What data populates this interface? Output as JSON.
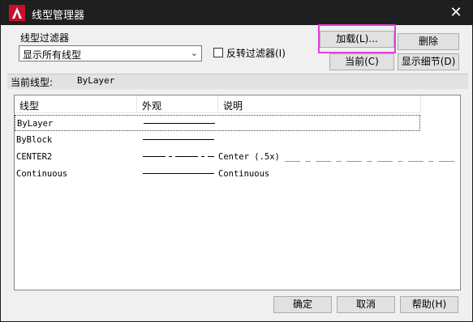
{
  "window": {
    "title": "线型管理器"
  },
  "filter": {
    "group_label": "线型过滤器",
    "selected": "显示所有线型",
    "invert_label": "反转过滤器(I)"
  },
  "buttons": {
    "load": "加载(L)...",
    "delete": "删除",
    "current": "当前(C)",
    "details": "显示细节(D)",
    "ok": "确定",
    "cancel": "取消",
    "help": "帮助(H)"
  },
  "current_linetype": {
    "label": "当前线型:",
    "value": "ByLayer"
  },
  "table": {
    "headers": [
      "线型",
      "外观",
      "说明"
    ],
    "rows": [
      {
        "name": "ByLayer",
        "pattern": "solid",
        "description": ""
      },
      {
        "name": "ByBlock",
        "pattern": "solid",
        "description": ""
      },
      {
        "name": "CENTER2",
        "pattern": "center",
        "description": "Center (.5x) ___ _ ___ _ ___ _ ___ _ ___ _ ___"
      },
      {
        "name": "Continuous",
        "pattern": "solid",
        "description": "Continuous"
      }
    ]
  },
  "colors": {
    "title_bar": "#1f1f1f",
    "highlight": "#e040e0",
    "dialog_bg": "#f0f0f0"
  }
}
